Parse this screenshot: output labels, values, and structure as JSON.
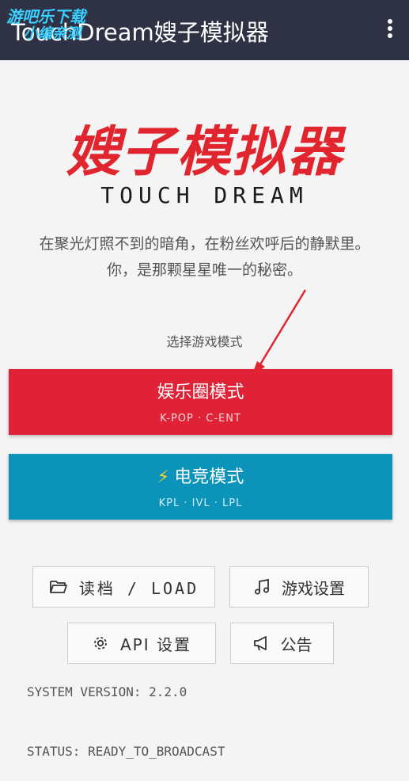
{
  "appbar": {
    "title": "TouchDream嫂子模拟器",
    "menu_icon": "more-vert-icon"
  },
  "watermark": {
    "line1": "游吧乐下载",
    "line2": "小编亲测"
  },
  "hero": {
    "logo": "嫂子模拟器",
    "subtitle": "TOUCH DREAM",
    "tagline_1": "在聚光灯照不到的暗角，在粉丝欢呼后的静默里。",
    "tagline_2": "你，是那颗星星唯一的秘密。"
  },
  "modes": {
    "prompt": "选择游戏模式",
    "entertainment": {
      "label": "娱乐圈模式",
      "sub": "K-POP · C-ENT",
      "color": "#e02236"
    },
    "esports": {
      "icon": "⚡",
      "label": "电竞模式",
      "sub": "KPL · IVL · LPL",
      "color": "#0c93b9"
    }
  },
  "buttons": {
    "load": "读档 / LOAD",
    "game_settings": "游戏设置",
    "api_settings": "API 设置",
    "notice": "公告"
  },
  "status": {
    "version": "SYSTEM VERSION: 2.2.0",
    "state": "STATUS: READY_TO_BROADCAST"
  },
  "annotation_color": "#e0252f"
}
